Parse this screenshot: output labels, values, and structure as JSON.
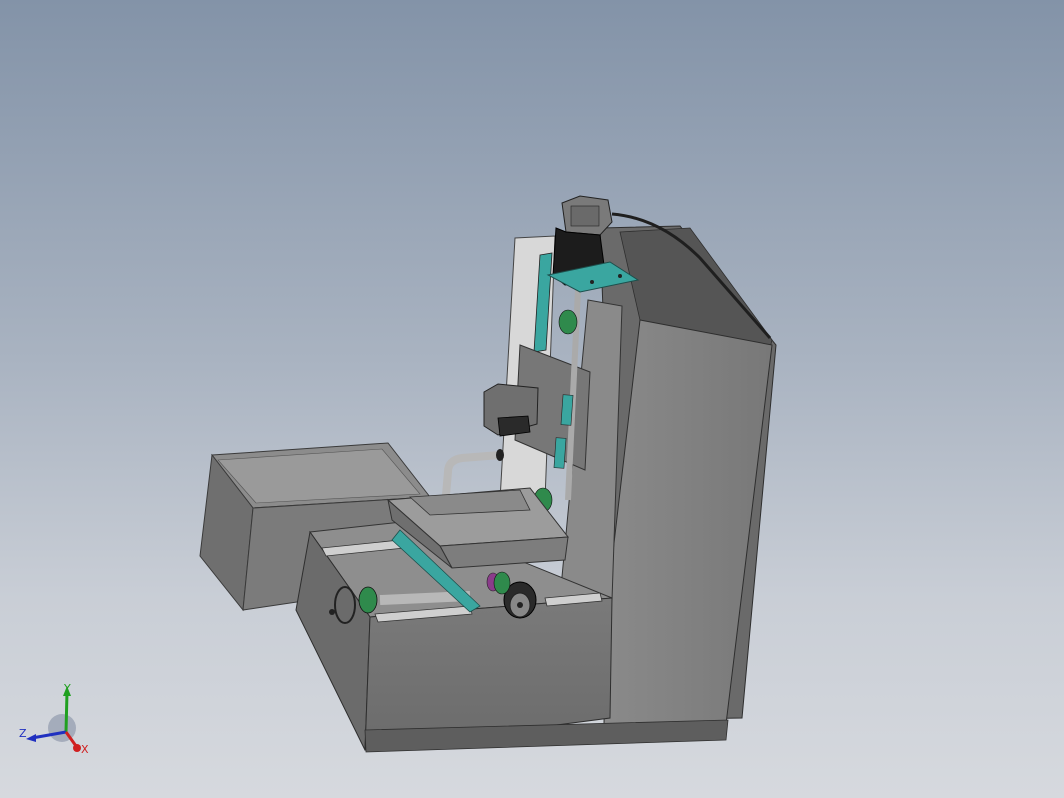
{
  "viewport": {
    "background_top": "#8393a8",
    "background_bottom": "#d6d9de"
  },
  "model": {
    "body_color": "#808080",
    "body_dark": "#5c5c5c",
    "body_light": "#9a9a9a",
    "accent_teal": "#3aa6a0",
    "accent_green": "#2f8a4c",
    "motor_color": "#1a1a1a",
    "pipe_color": "#b8b8b8"
  },
  "triad": {
    "x_label": "X",
    "y_label": "Y",
    "z_label": "Z",
    "x_color": "#d02020",
    "y_color": "#20a020",
    "z_color": "#2030c0"
  }
}
